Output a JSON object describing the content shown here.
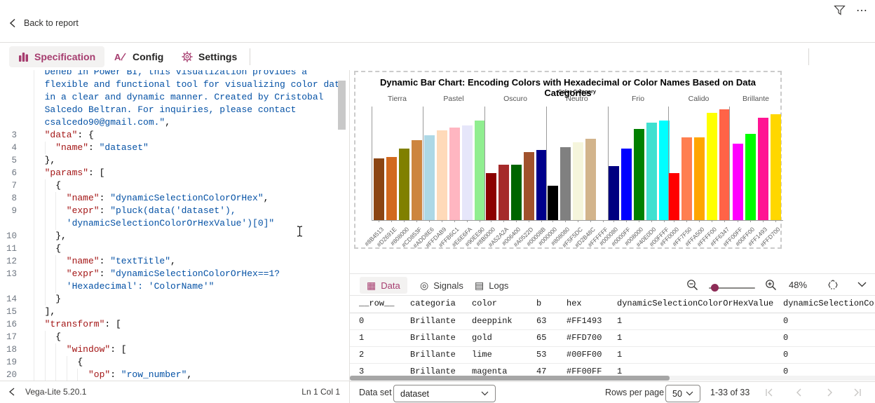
{
  "header": {
    "back_label": "Back to report"
  },
  "tabs": {
    "specification": "Specification",
    "config": "Config",
    "settings": "Settings"
  },
  "statusbar": {
    "engine": "Vega-Lite 5.20.1",
    "position": "Ln 1 Col 1"
  },
  "colors": {
    "accent": "#a63d6f",
    "editor_key": "#a31515",
    "editor_string": "#0451a5",
    "icon_gray": "#424242",
    "disabled_gray": "#c8c6c4"
  },
  "editor": {
    "rows": [
      {
        "n": "",
        "ind": 1,
        "seg": [
          [
            "s",
            "Deneb in Power BI, this visualization provides a"
          ]
        ]
      },
      {
        "n": "",
        "ind": 1,
        "seg": [
          [
            "s",
            "flexible and functional tool for visualizing color data"
          ]
        ]
      },
      {
        "n": "",
        "ind": 1,
        "seg": [
          [
            "s",
            "in a clear and dynamic manner. Created by Cristobal"
          ]
        ]
      },
      {
        "n": "",
        "ind": 1,
        "seg": [
          [
            "s",
            "Salcedo Beltran. For inquiries, please contact"
          ]
        ]
      },
      {
        "n": "",
        "ind": 1,
        "seg": [
          [
            "s",
            "csalcedo90@gmail.com.\""
          ],
          [
            "p",
            ","
          ]
        ]
      },
      {
        "n": "3",
        "ind": 1,
        "seg": [
          [
            "k",
            "\"data\""
          ],
          [
            "p",
            ": {"
          ]
        ]
      },
      {
        "n": "4",
        "ind": 2,
        "seg": [
          [
            "k",
            "\"name\""
          ],
          [
            "p",
            ": "
          ],
          [
            "s",
            "\"dataset\""
          ]
        ]
      },
      {
        "n": "5",
        "ind": 1,
        "seg": [
          [
            "p",
            "},"
          ]
        ]
      },
      {
        "n": "6",
        "ind": 1,
        "seg": [
          [
            "k",
            "\"params\""
          ],
          [
            "p",
            ": ["
          ]
        ]
      },
      {
        "n": "7",
        "ind": 2,
        "seg": [
          [
            "p",
            "{"
          ]
        ]
      },
      {
        "n": "8",
        "ind": 3,
        "seg": [
          [
            "k",
            "\"name\""
          ],
          [
            "p",
            ": "
          ],
          [
            "s",
            "\"dynamicSelectionColorOrHex\""
          ],
          [
            "p",
            ","
          ]
        ]
      },
      {
        "n": "9",
        "ind": 3,
        "seg": [
          [
            "k",
            "\"expr\""
          ],
          [
            "p",
            ": "
          ],
          [
            "s",
            "\"pluck(data('dataset'),"
          ]
        ]
      },
      {
        "n": "",
        "ind": 3,
        "seg": [
          [
            "s",
            "'dynamicSelectionColorOrHexValue')[0]\""
          ]
        ]
      },
      {
        "n": "10",
        "ind": 2,
        "seg": [
          [
            "p",
            "},"
          ]
        ]
      },
      {
        "n": "11",
        "ind": 2,
        "seg": [
          [
            "p",
            "{"
          ]
        ]
      },
      {
        "n": "12",
        "ind": 3,
        "seg": [
          [
            "k",
            "\"name\""
          ],
          [
            "p",
            ": "
          ],
          [
            "s",
            "\"textTitle\""
          ],
          [
            "p",
            ","
          ]
        ]
      },
      {
        "n": "13",
        "ind": 3,
        "seg": [
          [
            "k",
            "\"expr\""
          ],
          [
            "p",
            ": "
          ],
          [
            "s",
            "\"dynamicSelectionColorOrHex==1?"
          ]
        ]
      },
      {
        "n": "",
        "ind": 3,
        "seg": [
          [
            "s",
            "'Hexadecimal': 'ColorName'\""
          ]
        ]
      },
      {
        "n": "14",
        "ind": 2,
        "seg": [
          [
            "p",
            "}"
          ]
        ]
      },
      {
        "n": "15",
        "ind": 1,
        "seg": [
          [
            "p",
            "],"
          ]
        ]
      },
      {
        "n": "16",
        "ind": 1,
        "seg": [
          [
            "k",
            "\"transform\""
          ],
          [
            "p",
            ": ["
          ]
        ]
      },
      {
        "n": "17",
        "ind": 2,
        "seg": [
          [
            "p",
            "{"
          ]
        ]
      },
      {
        "n": "18",
        "ind": 3,
        "seg": [
          [
            "k",
            "\"window\""
          ],
          [
            "p",
            ": ["
          ]
        ]
      },
      {
        "n": "19",
        "ind": 4,
        "seg": [
          [
            "p",
            "{"
          ]
        ]
      },
      {
        "n": "20",
        "ind": 5,
        "seg": [
          [
            "k",
            "\"op\""
          ],
          [
            "p",
            ": "
          ],
          [
            "s",
            "\"row_number\""
          ],
          [
            "p",
            ","
          ]
        ]
      }
    ]
  },
  "chart_data": {
    "type": "bar",
    "title": "Dynamic Bar Chart: Encoding Colors with Hexadecimal or Color Names Based on Data Categories",
    "facet_field_title": "Color Category",
    "xlabel": "",
    "ylabel": "",
    "ylim": [
      0,
      70
    ],
    "facets": [
      {
        "name": "Tierra",
        "bars": [
          [
            "#8B4513",
            38
          ],
          [
            "#D2691E",
            39
          ],
          [
            "#808000",
            44
          ],
          [
            "#CD853F",
            49
          ]
        ]
      },
      {
        "name": "Pastel",
        "bars": [
          [
            "#ADD8E6",
            52
          ],
          [
            "#FFDAB9",
            55
          ],
          [
            "#FFB6C1",
            57
          ],
          [
            "#E6E6FA",
            58
          ],
          [
            "#90EE90",
            61
          ]
        ]
      },
      {
        "name": "Oscuro",
        "bars": [
          [
            "#8B0000",
            29
          ],
          [
            "#A52A2A",
            34
          ],
          [
            "#006400",
            34
          ],
          [
            "#A0522D",
            42
          ],
          [
            "#00008B",
            43
          ]
        ]
      },
      {
        "name": "Neutro",
        "bars": [
          [
            "#000000",
            21
          ],
          [
            "#808080",
            45
          ],
          [
            "#F5F5DC",
            48
          ],
          [
            "#D2B48C",
            50
          ],
          [
            "#FFFFFF",
            52
          ]
        ]
      },
      {
        "name": "Frio",
        "bars": [
          [
            "#000080",
            33
          ],
          [
            "#0000FF",
            44
          ],
          [
            "#008000",
            56
          ],
          [
            "#40E0D0",
            60
          ],
          [
            "#00FFFF",
            61
          ]
        ]
      },
      {
        "name": "Calido",
        "bars": [
          [
            "#FF0000",
            29
          ],
          [
            "#FF7F50",
            51
          ],
          [
            "#FFA500",
            51
          ],
          [
            "#FFFF00",
            66
          ],
          [
            "#FF6347",
            68
          ]
        ]
      },
      {
        "name": "Brillante",
        "bars": [
          [
            "#FF00FF",
            47
          ],
          [
            "#00FF00",
            53
          ],
          [
            "#FF1493",
            63
          ],
          [
            "#FFD700",
            65
          ]
        ]
      }
    ]
  },
  "data_panel": {
    "tabs": {
      "data": "Data",
      "signals": "Signals",
      "logs": "Logs"
    },
    "zoom_level": "48%",
    "table": {
      "columns": [
        "__row__",
        "categoria",
        "color",
        "b",
        "hex",
        "dynamicSelectionColorOrHexValue",
        "dynamicSelectionColo"
      ],
      "rows": [
        [
          "0",
          "Brillante",
          "deeppink",
          "63",
          "#FF1493",
          "1",
          "0"
        ],
        [
          "1",
          "Brillante",
          "gold",
          "65",
          "#FFD700",
          "1",
          "0"
        ],
        [
          "2",
          "Brillante",
          "lime",
          "53",
          "#00FF00",
          "1",
          "0"
        ],
        [
          "3",
          "Brillante",
          "magenta",
          "47",
          "#FF00FF",
          "1",
          "0"
        ]
      ]
    },
    "footer": {
      "dataset_label": "Data set",
      "dataset_value": "dataset",
      "rows_per_page_label": "Rows per page",
      "rows_per_page_value": "50",
      "range": "1-33 of 33"
    }
  }
}
